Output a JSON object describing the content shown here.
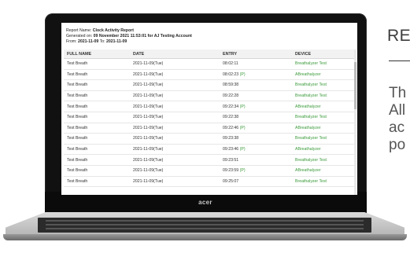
{
  "side": {
    "heading": "RE",
    "lines": [
      "Th",
      "All",
      "ac",
      "po"
    ]
  },
  "laptop": {
    "logo": "acer"
  },
  "report": {
    "name_label": "Report Name:",
    "name": "Clock Activity Report",
    "generated_label": "Generated on:",
    "generated": "09 November 2021 11:53:01 for AJ Testing Account",
    "from_label": "From:",
    "from": "2021-11-09",
    "to_label": "To:",
    "to": "2021-11-09"
  },
  "table": {
    "columns": [
      "FULL NAME",
      "DATE",
      "ENTRY",
      "DEVICE"
    ],
    "rows": [
      {
        "name": "Test Breath",
        "date": "2021-11-09(Tue)",
        "entry": "08:02:11",
        "flag": "",
        "device": "Breathalyzer Test"
      },
      {
        "name": "Test Breath",
        "date": "2021-11-09(Tue)",
        "entry": "08:02:23",
        "flag": "(P)",
        "device": "ABreathalyzer"
      },
      {
        "name": "Test Breath",
        "date": "2021-11-09(Tue)",
        "entry": "08:59:38",
        "flag": "",
        "device": "Breathalyzer Test"
      },
      {
        "name": "Test Breath",
        "date": "2021-11-09(Tue)",
        "entry": "09:22:28",
        "flag": "",
        "device": "Breathalyzer Test"
      },
      {
        "name": "Test Breath",
        "date": "2021-11-09(Tue)",
        "entry": "09:22:34",
        "flag": "(P)",
        "device": "ABreathalyzer"
      },
      {
        "name": "Test Breath",
        "date": "2021-11-09(Tue)",
        "entry": "09:22:38",
        "flag": "",
        "device": "Breathalyzer Test"
      },
      {
        "name": "Test Breath",
        "date": "2021-11-09(Tue)",
        "entry": "09:22:46",
        "flag": "(P)",
        "device": "ABreathalyzer"
      },
      {
        "name": "Test Breath",
        "date": "2021-11-09(Tue)",
        "entry": "09:23:38",
        "flag": "",
        "device": "Breathalyzer Test"
      },
      {
        "name": "Test Breath",
        "date": "2021-11-09(Tue)",
        "entry": "09:23:46",
        "flag": "(P)",
        "device": "ABreathalyzer"
      },
      {
        "name": "Test Breath",
        "date": "2021-11-09(Tue)",
        "entry": "09:23:51",
        "flag": "",
        "device": "Breathalyzer Test"
      },
      {
        "name": "Test Breath",
        "date": "2021-11-09(Tue)",
        "entry": "09:23:59",
        "flag": "(P)",
        "device": "ABreathalyzer"
      },
      {
        "name": "Test Breath",
        "date": "2021-11-09(Tue)",
        "entry": "09:25:07",
        "flag": "",
        "device": "Breathalyzer Test"
      }
    ]
  },
  "colors": {
    "device_text": "#3a9a3a",
    "bezel": "#111111"
  }
}
